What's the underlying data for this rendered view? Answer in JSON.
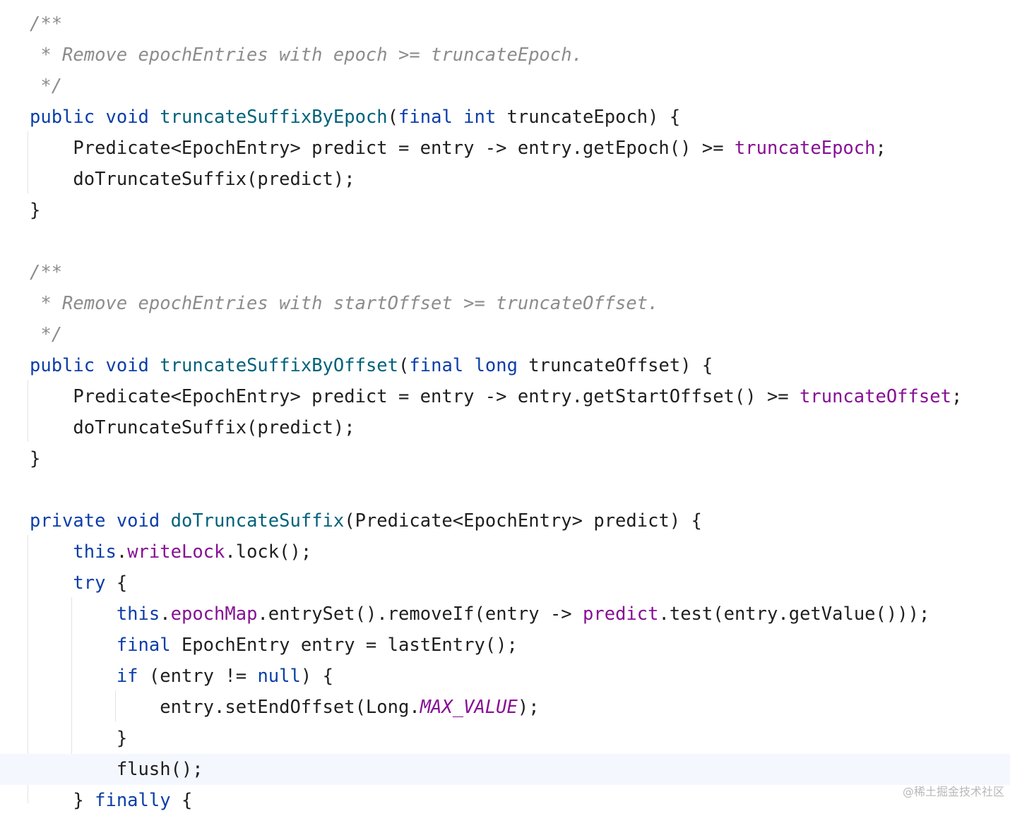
{
  "editor": {
    "active_line": 24,
    "lines": [
      [
        {
          "t": "/**",
          "c": "cmt"
        }
      ],
      [
        {
          "t": " * Remove epochEntries with epoch >= truncateEpoch.",
          "c": "cmt"
        }
      ],
      [
        {
          "t": " */",
          "c": "cmt"
        }
      ],
      [
        {
          "t": "public",
          "c": "kw"
        },
        {
          "t": " ",
          "c": "plain"
        },
        {
          "t": "void",
          "c": "kw"
        },
        {
          "t": " ",
          "c": "plain"
        },
        {
          "t": "truncateSuffixByEpoch",
          "c": "fn"
        },
        {
          "t": "(",
          "c": "plain"
        },
        {
          "t": "final",
          "c": "kw"
        },
        {
          "t": " ",
          "c": "plain"
        },
        {
          "t": "int",
          "c": "kw"
        },
        {
          "t": " truncateEpoch) {",
          "c": "plain"
        }
      ],
      [
        {
          "t": "    Predicate<EpochEntry> predict = entry -> entry.getEpoch() >= ",
          "c": "plain"
        },
        {
          "t": "truncateEpoch",
          "c": "field"
        },
        {
          "t": ";",
          "c": "plain"
        }
      ],
      [
        {
          "t": "    doTruncateSuffix(predict);",
          "c": "plain"
        }
      ],
      [
        {
          "t": "}",
          "c": "plain"
        }
      ],
      [],
      [
        {
          "t": "/**",
          "c": "cmt"
        }
      ],
      [
        {
          "t": " * Remove epochEntries with startOffset >= truncateOffset.",
          "c": "cmt"
        }
      ],
      [
        {
          "t": " */",
          "c": "cmt"
        }
      ],
      [
        {
          "t": "public",
          "c": "kw"
        },
        {
          "t": " ",
          "c": "plain"
        },
        {
          "t": "void",
          "c": "kw"
        },
        {
          "t": " ",
          "c": "plain"
        },
        {
          "t": "truncateSuffixByOffset",
          "c": "fn"
        },
        {
          "t": "(",
          "c": "plain"
        },
        {
          "t": "final",
          "c": "kw"
        },
        {
          "t": " ",
          "c": "plain"
        },
        {
          "t": "long",
          "c": "kw"
        },
        {
          "t": " truncateOffset) {",
          "c": "plain"
        }
      ],
      [
        {
          "t": "    Predicate<EpochEntry> predict = entry -> entry.getStartOffset() >= ",
          "c": "plain"
        },
        {
          "t": "truncateOffset",
          "c": "field"
        },
        {
          "t": ";",
          "c": "plain"
        }
      ],
      [
        {
          "t": "    doTruncateSuffix(predict);",
          "c": "plain"
        }
      ],
      [
        {
          "t": "}",
          "c": "plain"
        }
      ],
      [],
      [
        {
          "t": "private",
          "c": "kw"
        },
        {
          "t": " ",
          "c": "plain"
        },
        {
          "t": "void",
          "c": "kw"
        },
        {
          "t": " ",
          "c": "plain"
        },
        {
          "t": "doTruncateSuffix",
          "c": "fn"
        },
        {
          "t": "(Predicate<EpochEntry> predict) {",
          "c": "plain"
        }
      ],
      [
        {
          "t": "    ",
          "c": "plain"
        },
        {
          "t": "this",
          "c": "kw"
        },
        {
          "t": ".",
          "c": "plain"
        },
        {
          "t": "writeLock",
          "c": "field"
        },
        {
          "t": ".lock();",
          "c": "plain"
        }
      ],
      [
        {
          "t": "    ",
          "c": "plain"
        },
        {
          "t": "try",
          "c": "kw"
        },
        {
          "t": " {",
          "c": "plain"
        }
      ],
      [
        {
          "t": "        ",
          "c": "plain"
        },
        {
          "t": "this",
          "c": "kw"
        },
        {
          "t": ".",
          "c": "plain"
        },
        {
          "t": "epochMap",
          "c": "field"
        },
        {
          "t": ".entrySet().removeIf(entry -> ",
          "c": "plain"
        },
        {
          "t": "predict",
          "c": "field"
        },
        {
          "t": ".test(entry.getValue()));",
          "c": "plain"
        }
      ],
      [
        {
          "t": "        ",
          "c": "plain"
        },
        {
          "t": "final",
          "c": "kw"
        },
        {
          "t": " EpochEntry entry = lastEntry();",
          "c": "plain"
        }
      ],
      [
        {
          "t": "        ",
          "c": "plain"
        },
        {
          "t": "if",
          "c": "kw"
        },
        {
          "t": " (entry != ",
          "c": "plain"
        },
        {
          "t": "null",
          "c": "kw"
        },
        {
          "t": ") {",
          "c": "plain"
        }
      ],
      [
        {
          "t": "            entry.setEndOffset(Long.",
          "c": "plain"
        },
        {
          "t": "MAX_VALUE",
          "c": "static"
        },
        {
          "t": ");",
          "c": "plain"
        }
      ],
      [
        {
          "t": "        }",
          "c": "plain"
        }
      ],
      [
        {
          "t": "        flush();",
          "c": "plain"
        }
      ],
      [
        {
          "t": "    } ",
          "c": "plain"
        },
        {
          "t": "finally",
          "c": "kw"
        },
        {
          "t": " {",
          "c": "plain"
        }
      ]
    ]
  },
  "watermark": "@稀土掘金技术社区"
}
